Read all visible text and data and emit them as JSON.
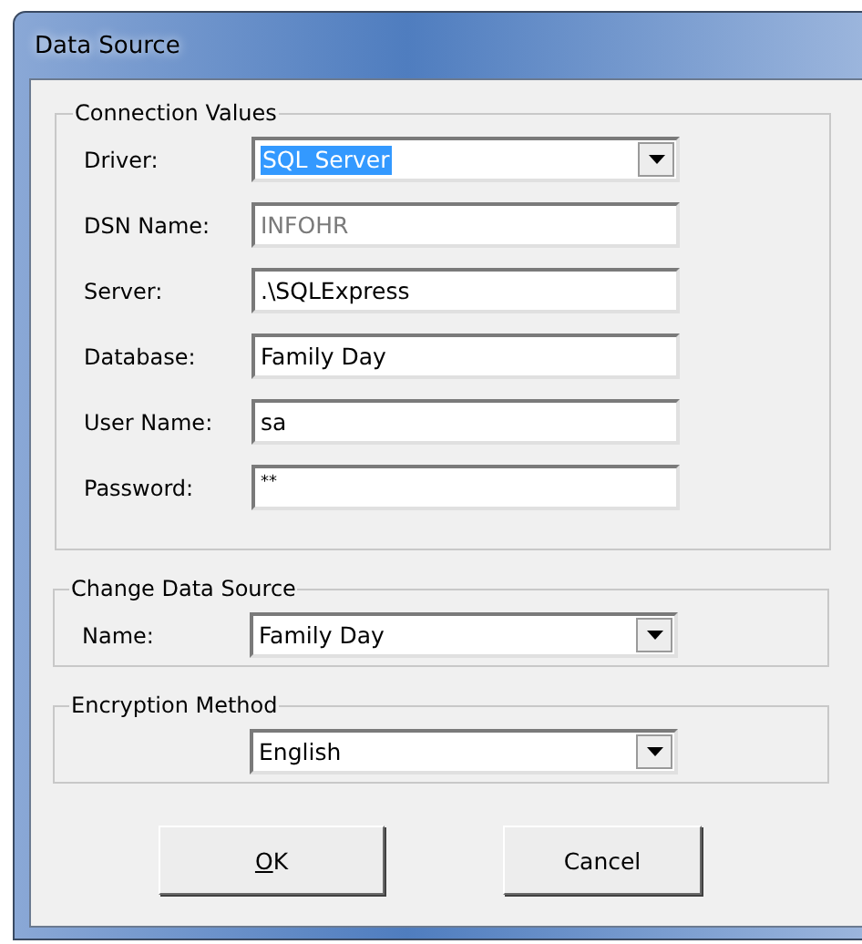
{
  "window": {
    "title": "Data Source"
  },
  "groups": [
    {
      "title": "Connection Values",
      "fields": [
        {
          "label": "Driver:",
          "kind": "dropdown",
          "value": "SQL Server",
          "highlighted": true,
          "disabled": false
        },
        {
          "label": "DSN Name:",
          "kind": "text",
          "value": "INFOHR",
          "highlighted": false,
          "disabled": true
        },
        {
          "label": "Server:",
          "kind": "text",
          "value": ".\\SQLExpress",
          "highlighted": false,
          "disabled": false
        },
        {
          "label": "Database:",
          "kind": "text",
          "value": "Family Day",
          "highlighted": false,
          "disabled": false
        },
        {
          "label": "User Name:",
          "kind": "text",
          "value": "sa",
          "highlighted": false,
          "disabled": false
        },
        {
          "label": "Password:",
          "kind": "password",
          "value": "**",
          "highlighted": false,
          "disabled": false
        }
      ]
    },
    {
      "title": "Change Data Source",
      "fields": [
        {
          "label": "Name:",
          "kind": "dropdown",
          "value": "Family Day",
          "highlighted": false,
          "disabled": false
        }
      ]
    },
    {
      "title": "Encryption Method",
      "fields": [
        {
          "kind": "dropdown",
          "value": "English",
          "highlighted": false,
          "disabled": false
        }
      ]
    }
  ],
  "buttons": [
    {
      "label": "OK",
      "mnemonic_first": true
    },
    {
      "label": "Cancel",
      "mnemonic_first": false
    }
  ]
}
